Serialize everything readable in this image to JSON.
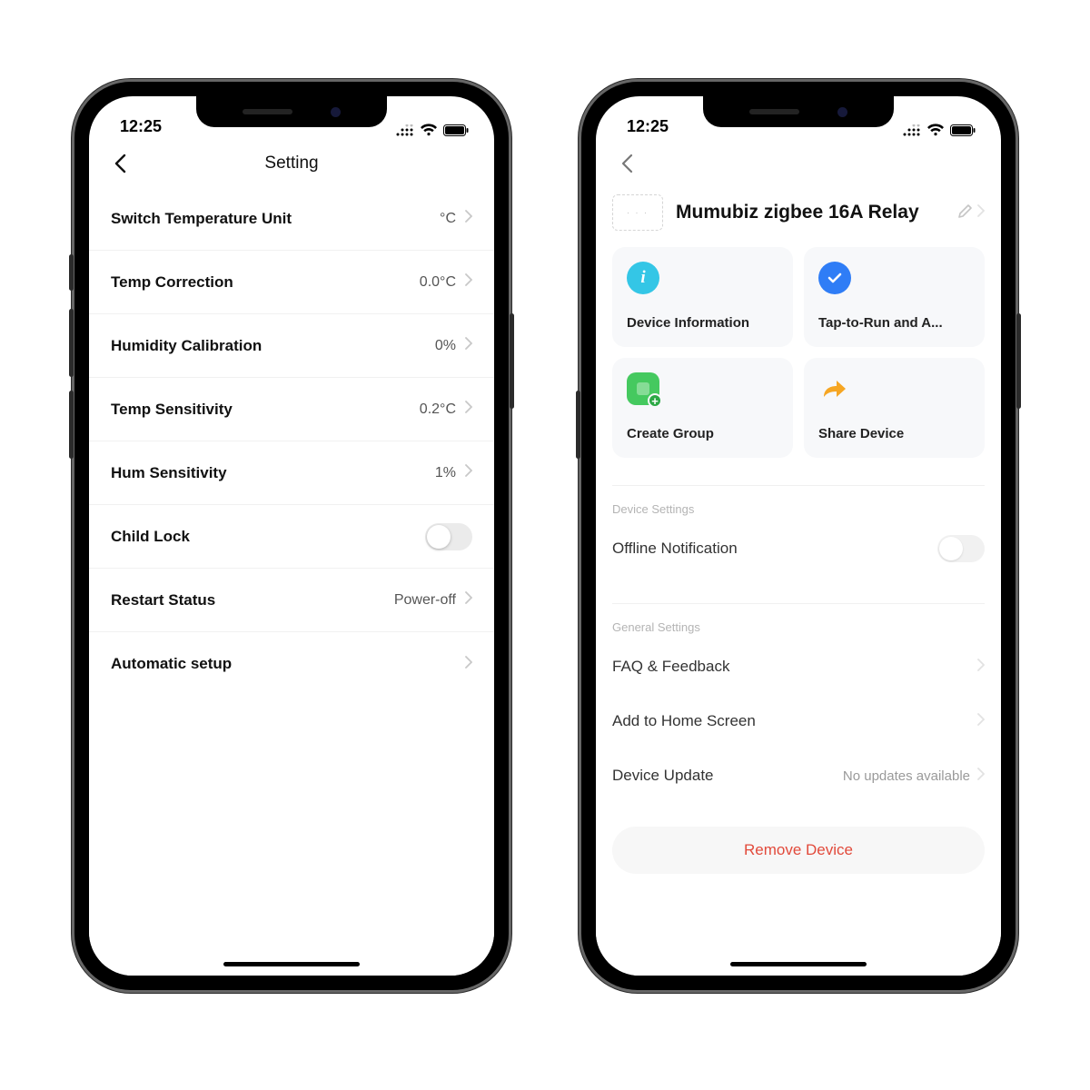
{
  "statusbar": {
    "time": "12:25"
  },
  "screenA": {
    "title": "Setting",
    "rows": [
      {
        "label": "Switch Temperature Unit",
        "value": "°C"
      },
      {
        "label": "Temp Correction",
        "value": "0.0°C"
      },
      {
        "label": "Humidity Calibration",
        "value": "0%"
      },
      {
        "label": "Temp Sensitivity",
        "value": "0.2°C"
      },
      {
        "label": "Hum Sensitivity",
        "value": "1%"
      },
      {
        "label": "Child Lock",
        "toggle": false
      },
      {
        "label": "Restart Status",
        "value": "Power-off"
      },
      {
        "label": "Automatic setup",
        "value": ""
      }
    ]
  },
  "screenB": {
    "device_name": "Mumubiz zigbee 16A Relay",
    "tiles": [
      {
        "icon": "info",
        "label": "Device Information"
      },
      {
        "icon": "check",
        "label": "Tap-to-Run and A..."
      },
      {
        "icon": "group",
        "label": "Create Group"
      },
      {
        "icon": "share",
        "label": "Share Device"
      }
    ],
    "device_settings_header": "Device Settings",
    "offline_notification_label": "Offline Notification",
    "offline_notification_on": false,
    "general_settings_header": "General Settings",
    "general_rows": [
      {
        "label": "FAQ & Feedback",
        "value": ""
      },
      {
        "label": "Add to Home Screen",
        "value": ""
      },
      {
        "label": "Device Update",
        "value": "No updates available"
      }
    ],
    "remove_label": "Remove Device"
  }
}
